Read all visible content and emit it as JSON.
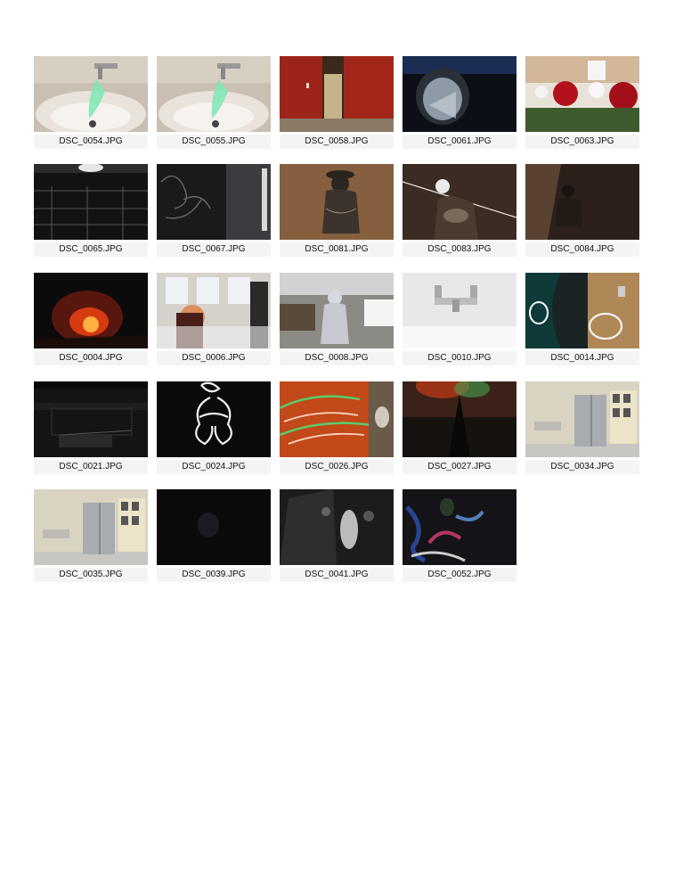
{
  "contact_sheet": {
    "thumbnails": [
      {
        "filename": "DSC_0054.JPG",
        "scene": "sink-faucet-green-light"
      },
      {
        "filename": "DSC_0055.JPG",
        "scene": "sink-faucet-green-light"
      },
      {
        "filename": "DSC_0058.JPG",
        "scene": "red-doors"
      },
      {
        "filename": "DSC_0061.JPG",
        "scene": "dark-window-reflection"
      },
      {
        "filename": "DSC_0063.JPG",
        "scene": "red-roses"
      },
      {
        "filename": "DSC_0065.JPG",
        "scene": "dark-rack"
      },
      {
        "filename": "DSC_0067.JPG",
        "scene": "dark-wires"
      },
      {
        "filename": "DSC_0081.JPG",
        "scene": "bronze-statue"
      },
      {
        "filename": "DSC_0083.JPG",
        "scene": "bronze-statue-light"
      },
      {
        "filename": "DSC_0084.JPG",
        "scene": "bronze-statue-dark"
      },
      {
        "filename": "DSC_0004.JPG",
        "scene": "red-fire-glow"
      },
      {
        "filename": "DSC_0006.JPG",
        "scene": "salon-light-painting"
      },
      {
        "filename": "DSC_0008.JPG",
        "scene": "silver-figure-bathroom"
      },
      {
        "filename": "DSC_0010.JPG",
        "scene": "white-sink-faucet"
      },
      {
        "filename": "DSC_0014.JPG",
        "scene": "teal-wall-light-loops"
      },
      {
        "filename": "DSC_0021.JPG",
        "scene": "dark-room"
      },
      {
        "filename": "DSC_0024.JPG",
        "scene": "white-light-drawing"
      },
      {
        "filename": "DSC_0026.JPG",
        "scene": "orange-green-light-streaks"
      },
      {
        "filename": "DSC_0027.JPG",
        "scene": "red-green-ceiling-glow"
      },
      {
        "filename": "DSC_0034.JPG",
        "scene": "hallway-doors"
      },
      {
        "filename": "DSC_0035.JPG",
        "scene": "hallway-doors"
      },
      {
        "filename": "DSC_0039.JPG",
        "scene": "near-black"
      },
      {
        "filename": "DSC_0041.JPG",
        "scene": "dark-sink-light"
      },
      {
        "filename": "DSC_0052.JPG",
        "scene": "dark-graffiti"
      }
    ]
  }
}
